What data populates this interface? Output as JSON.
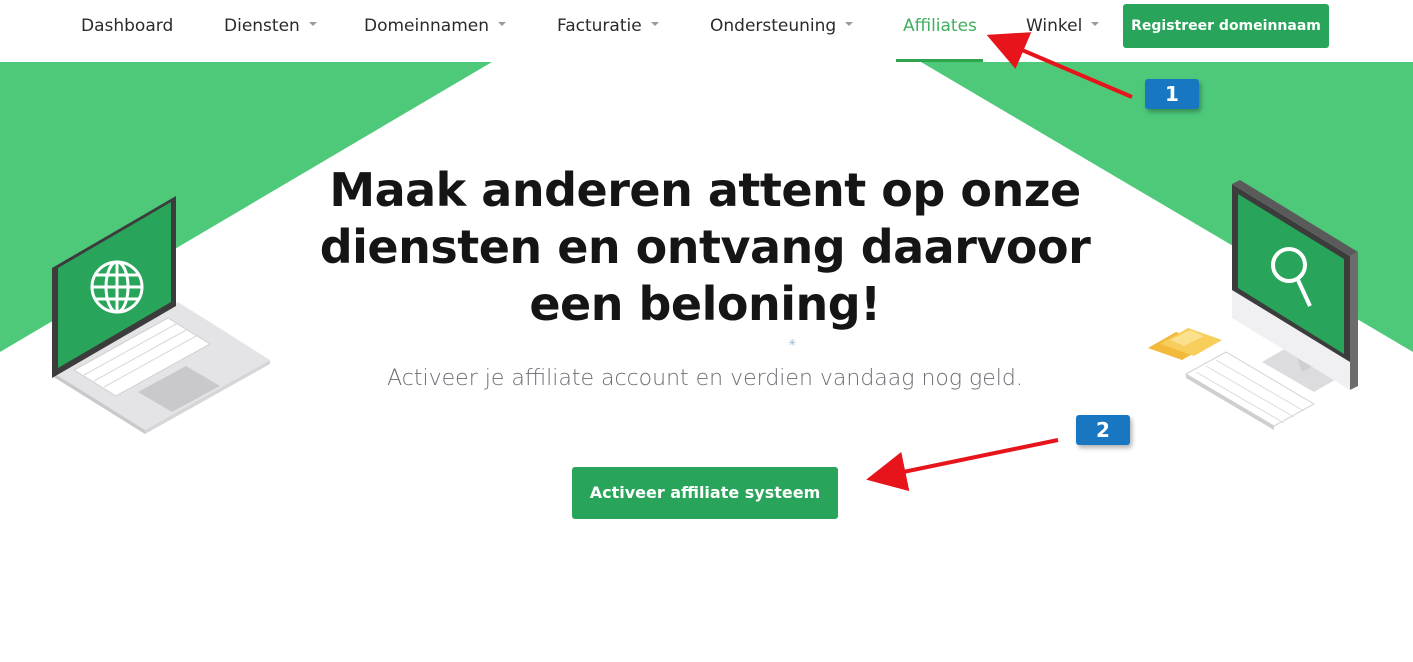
{
  "nav": {
    "items": [
      {
        "label": "Dashboard",
        "has_dropdown": false,
        "active": false
      },
      {
        "label": "Diensten",
        "has_dropdown": true,
        "active": false
      },
      {
        "label": "Domeinnamen",
        "has_dropdown": true,
        "active": false
      },
      {
        "label": "Facturatie",
        "has_dropdown": true,
        "active": false
      },
      {
        "label": "Ondersteuning",
        "has_dropdown": true,
        "active": false
      },
      {
        "label": "Affiliates",
        "has_dropdown": false,
        "active": true
      },
      {
        "label": "Winkel",
        "has_dropdown": true,
        "active": false
      }
    ],
    "register_button": "Registreer domeinnaam"
  },
  "hero": {
    "headline": "Maak anderen attent op onze diensten en ontvang daarvoor een beloning!",
    "subline": "Activeer je affiliate account en verdien vandaag nog geld.",
    "cta_button": "Activeer affiliate systeem",
    "left_illustration": "laptop-globe-icon",
    "right_illustration": "desktop-search-icon"
  },
  "annotations": {
    "badge_1": "1",
    "badge_2": "2"
  },
  "colors": {
    "brand_green": "#28a55a",
    "bg_green": "#4ec97a",
    "active_text": "#3fae5f",
    "annotation_blue": "#1977c2",
    "arrow_red": "#e8141b"
  }
}
